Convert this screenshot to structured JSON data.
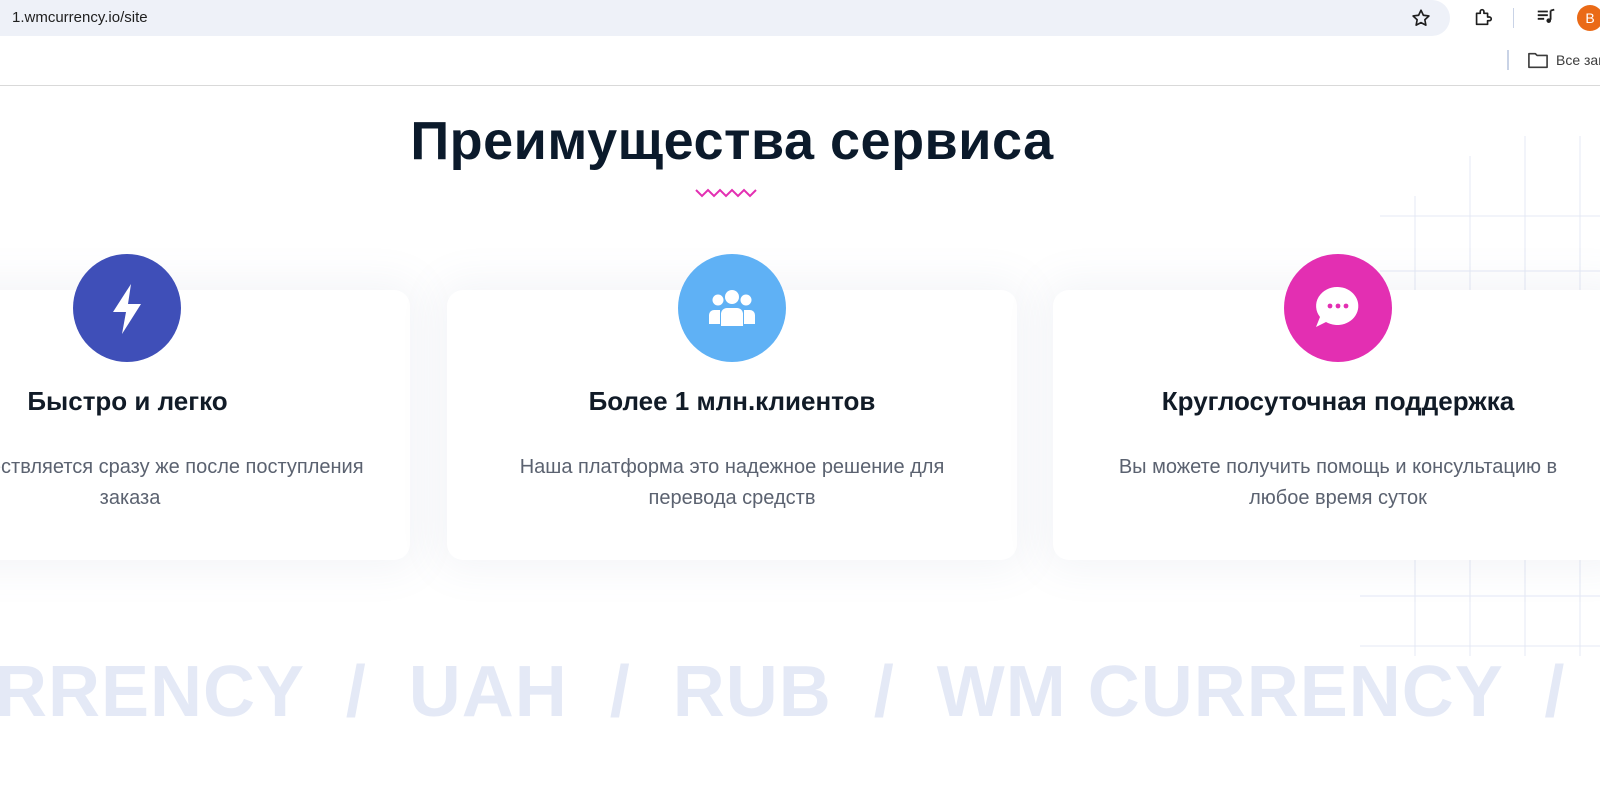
{
  "browser": {
    "url": "1.wmcurrency.io/site",
    "avatar_letter": "B",
    "avatar_color": "#ea6a17",
    "icons": [
      "star-icon",
      "extensions-icon",
      "media-icon",
      "folder-icon"
    ],
    "bookmarks_label": "Все зак"
  },
  "section": {
    "title": "Преимущества сервиса",
    "accent_color": "#e32fb2"
  },
  "features": [
    {
      "title": "Быстро и легко",
      "description": "енег осуществляется сразу же после поступления заказа",
      "icon": "lightning-icon",
      "color": "#3f4fb8"
    },
    {
      "title": "Более 1 млн.клиентов",
      "description": "Наша платформа это надежное решение для перевода средств",
      "icon": "users-icon",
      "color": "#5fb1f5"
    },
    {
      "title": "Круглосуточная поддержка",
      "description": "Вы можете получить помощь и консультацию в любое время суток",
      "icon": "chat-bubble-icon",
      "color": "#e32fb2"
    }
  ],
  "marquee": {
    "text": "RRENCY  /  UAH  /  RUB  /  WM CURRENCY  /  U"
  }
}
